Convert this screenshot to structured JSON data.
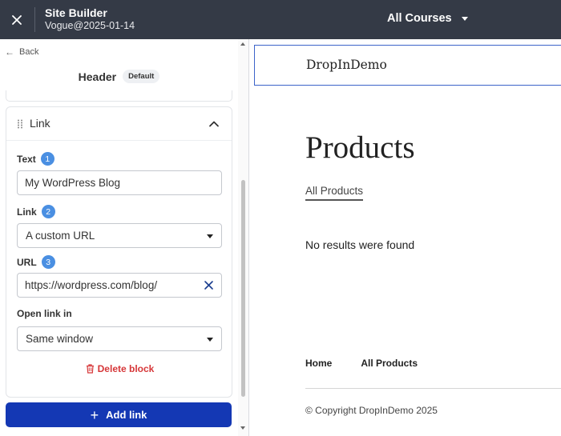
{
  "topbar": {
    "title": "Site Builder",
    "subtitle": "Vogue@2025-01-14",
    "course_selector": "All Courses",
    "close_icon": "close-icon"
  },
  "left_panel": {
    "back_label": "Back",
    "block_title": "Header",
    "block_badge": "Default",
    "link_card": {
      "title": "Link",
      "fields": {
        "text": {
          "label": "Text",
          "badge": "1",
          "value": "My WordPress Blog"
        },
        "link": {
          "label": "Link",
          "badge": "2",
          "value": "A custom URL"
        },
        "url": {
          "label": "URL",
          "badge": "3",
          "value": "https://wordpress.com/blog/"
        },
        "open_in": {
          "label": "Open link in",
          "value": "Same window"
        }
      },
      "delete_label": "Delete block"
    },
    "add_link_label": "Add link"
  },
  "preview": {
    "site_name": "DropInDemo",
    "page_heading": "Products",
    "breadcrumb": "All Products",
    "empty_message": "No results were found",
    "footer_links": [
      "Home",
      "All Products"
    ],
    "copyright": "© Copyright DropInDemo 2025"
  },
  "colors": {
    "topbar_bg": "#343a46",
    "primary_button": "#1438b4",
    "badge_blue": "#4a8fe2",
    "delete_red": "#d63638",
    "preview_header_border": "#3c63c9"
  }
}
